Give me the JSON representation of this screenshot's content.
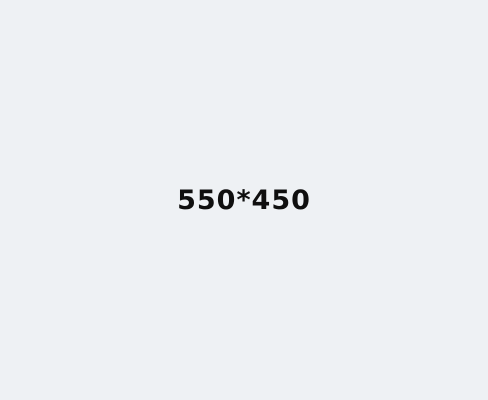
{
  "placeholder": {
    "label": "550*450",
    "background_color": "#eef1f4",
    "text_color": "#0f0f0f"
  }
}
